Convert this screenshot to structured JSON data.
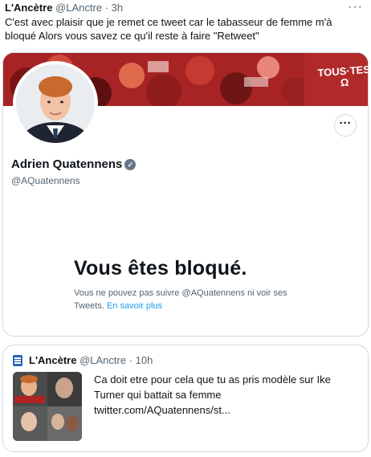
{
  "tweet": {
    "author_name": "L'Ancètre",
    "handle": "@LAnctre",
    "time": "3h",
    "text": "C'est avec plaisir que je remet ce tweet car le tabasseur de femme m'à bloqué Alors vous savez ce qu'il reste à faire \"Retweet\"",
    "more_label": "···"
  },
  "profile_card": {
    "banner_text_line1": "TOUS·TES",
    "banner_text_line2": "Ω",
    "name": "Adrien Quatennens",
    "verified_icon": "✓",
    "handle": "@AQuatennens",
    "more_label": "···",
    "blocked_title": "Vous êtes bloqué.",
    "blocked_message": "Vous ne pouvez pas suivre @AQuatennens ni voir ses Tweets.",
    "learn_more": "En savoir plus"
  },
  "quoted_tweet": {
    "author_name": "L'Ancètre",
    "handle": "@LAnctre",
    "time": "10h",
    "text": "Ca doit etre pour cela que tu as pris modèle sur Ike Turner qui battait sa femme twitter.com/AQuatennens/st..."
  },
  "colors": {
    "link": "#1d9bf0",
    "muted": "#536471",
    "banner_red": "#b02828"
  }
}
